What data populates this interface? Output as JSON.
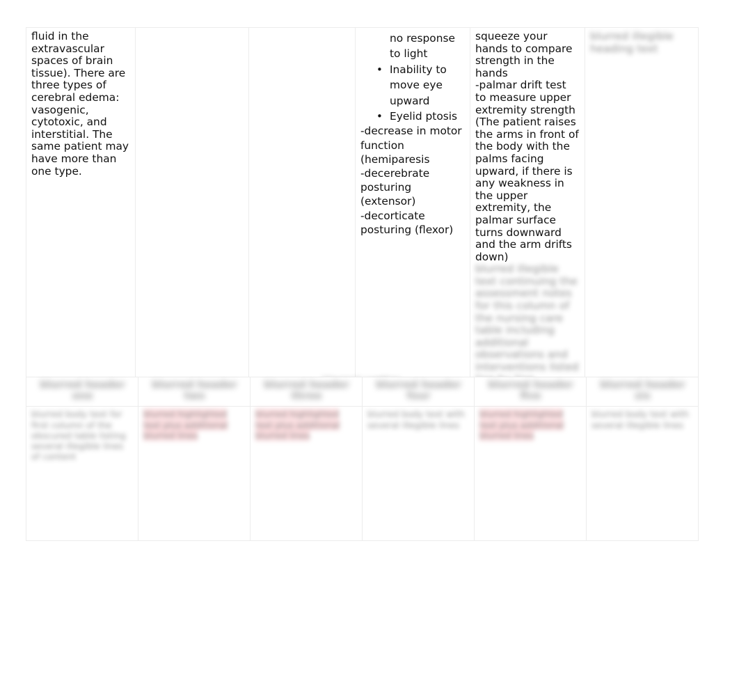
{
  "document": {
    "page_background": "#ffffff",
    "text_color": "#111111",
    "border_color": "#ececec",
    "highlight_pink": "#fac7cb"
  },
  "table_one": {
    "name": "increased-intracranial-pressure-table",
    "columns": 6,
    "row": {
      "col1": {
        "text": "fluid in the extravascular spaces of brain tissue). There are three types of cerebral edema: vasogenic, cytotoxic, and interstitial. The same patient may have more than one type."
      },
      "col2": {
        "text": ""
      },
      "col3": {
        "text": ""
      },
      "col4": {
        "continued_line": "no response to light",
        "bullets": [
          "Inability to move eye upward",
          "Eyelid ptosis"
        ],
        "dash_lines": [
          "-decrease in motor function (hemiparesis",
          "-decerebrate posturing (extensor)",
          "-decorticate posturing (flexor)"
        ]
      },
      "col5": {
        "text": "squeeze your hands to compare strength in the hands",
        "dash_text": "-palmar drift test to measure upper extremity strength (The patient raises the arms in front of the body with the palms facing upward, if there is any weakness in the upper extremity, the palmar surface turns downward and the arm drifts down)",
        "obscured_text": "blurred illegible text continuing the assessment notes for this column of the nursing care table including additional observations and interventions listed line by line"
      },
      "col6": {
        "obscured_text": "blurred illegible heading text"
      }
    }
  },
  "table_two": {
    "name": "obscured-comparison-table",
    "caption_obscured": "blurred caption",
    "headers_obscured": [
      "blurred header one",
      "blurred header two",
      "blurred header three",
      "blurred header four",
      "blurred header five",
      "blurred header six"
    ],
    "rows_obscured": [
      {
        "c1": "blurred body text for first column of the obscured table listing several illegible lines of content",
        "c2": "blurred highlighted text plus additional blurred lines",
        "c3": "blurred highlighted text plus additional blurred lines",
        "c4": "blurred body text with several illegible lines",
        "c5": "blurred highlighted text plus additional blurred lines",
        "c6": "blurred body text with several illegible lines"
      }
    ]
  }
}
